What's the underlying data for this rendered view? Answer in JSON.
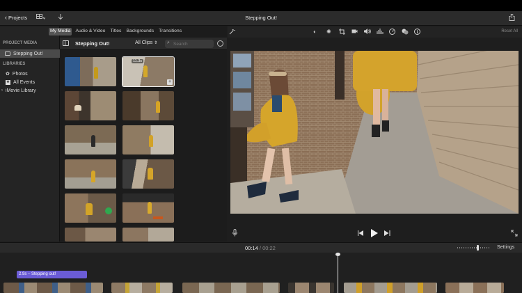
{
  "titlebar": {
    "back_label": "Projects",
    "project_title": "Stepping Out!"
  },
  "sidebar": {
    "project_media_header": "PROJECT MEDIA",
    "project_item": "Stepping Out!",
    "libraries_header": "LIBRARIES",
    "libraries": [
      "Photos",
      "All Events",
      "iMovie Library"
    ]
  },
  "browser": {
    "tabs": [
      "My Media",
      "Audio & Video",
      "Titles",
      "Backgrounds",
      "Transitions"
    ],
    "active_tab": "My Media",
    "library_title": "Stepping Out!",
    "filter_label": "All Clips",
    "search_placeholder": "Search",
    "clip_duration_badge": "11.3s"
  },
  "viewer": {
    "reset_all_label": "Reset All",
    "tools": [
      "color-balance-icon",
      "color-correction-icon",
      "crop-icon",
      "stabilization-icon",
      "volume-icon",
      "noise-reduction-icon",
      "speed-icon",
      "video-filter-icon",
      "info-icon"
    ]
  },
  "timeline": {
    "current_time": "00:14",
    "separator": "/",
    "total_time": "00:22",
    "settings_label": "Settings",
    "title_clip_label": "2.9s – Stepping out!"
  },
  "colors": {
    "accent_title_clip": "#6b5cd6",
    "selection_outline": "#f0f0f0"
  }
}
